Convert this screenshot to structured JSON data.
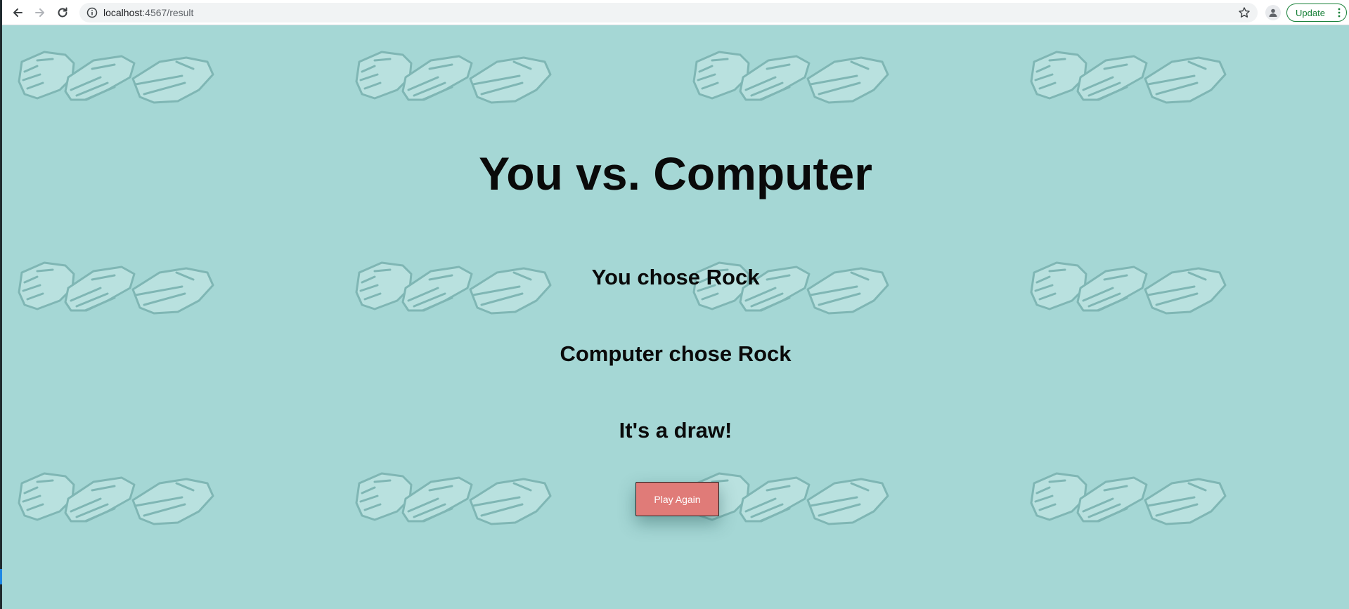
{
  "browser": {
    "url_host": "localhost",
    "url_port_path": ":4567/result",
    "update_label": "Update"
  },
  "page": {
    "title": "You vs. Computer",
    "user_choice": "You chose Rock",
    "computer_choice": "Computer chose Rock",
    "result": "It's a draw!",
    "play_again_label": "Play Again"
  },
  "colors": {
    "background": "#a5d7d5",
    "button": "#e07b78",
    "update_green": "#188038"
  }
}
